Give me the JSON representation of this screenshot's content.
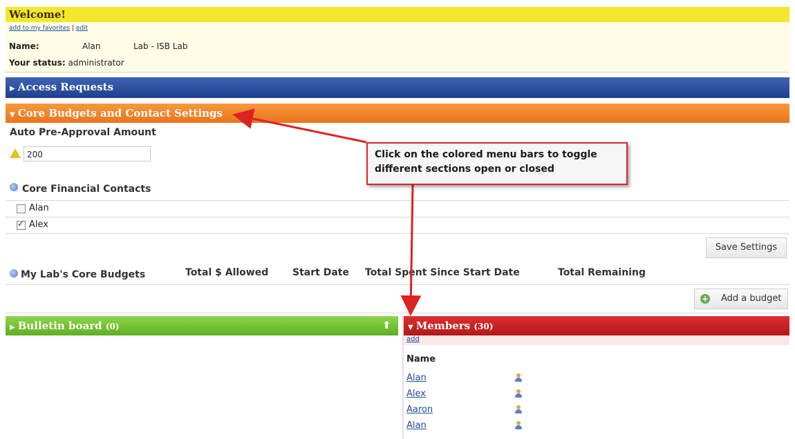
{
  "welcome": {
    "title": "Welcome!",
    "add_favorites": "add to my favorites",
    "separator": "|",
    "edit": "edit",
    "name_label": "Name:",
    "name_value_first": "Alan",
    "name_value_lab": "Lab - ISB Lab",
    "status_label": "Your status:",
    "status_value": "administrator"
  },
  "sections": {
    "access_requests": "Access Requests",
    "core_budgets": "Core Budgets and Contact Settings",
    "bulletin_board": "Bulletin board",
    "bulletin_count": "(0)",
    "members": "Members",
    "members_count": "(30)"
  },
  "core": {
    "preapproval_label": "Auto Pre-Approval Amount",
    "preapproval_value": "200",
    "contacts_label": "Core Financial Contacts",
    "contacts": [
      {
        "name": "Alan",
        "checked": false
      },
      {
        "name": "Alex",
        "checked": true
      }
    ],
    "save_button": "Save Settings",
    "budgets_label": "My Lab's Core Budgets",
    "budget_columns": [
      "Total $ Allowed",
      "Start Date",
      "Total Spent Since Start Date",
      "Total Remaining"
    ],
    "add_budget_button": "Add a budget"
  },
  "callout": {
    "line1": "Click on the colored menu bars to toggle",
    "line2": "different sections open or closed"
  },
  "members": {
    "add_link": "add",
    "name_header": "Name",
    "list": [
      "Alan",
      "Alex",
      "Aaron",
      "Alan"
    ]
  },
  "colors": {
    "welcome_bar": "#f2e72a",
    "access_bar": "#2a4c9f",
    "core_bar": "#ef8428",
    "bulletin_bar": "#74c233",
    "members_bar": "#c82020",
    "callout_border": "#dd2222"
  },
  "icons": {
    "warning": "warning-icon",
    "help": "help-icon",
    "add": "plus-circle-icon",
    "person": "person-icon",
    "pin": "pin-icon"
  }
}
